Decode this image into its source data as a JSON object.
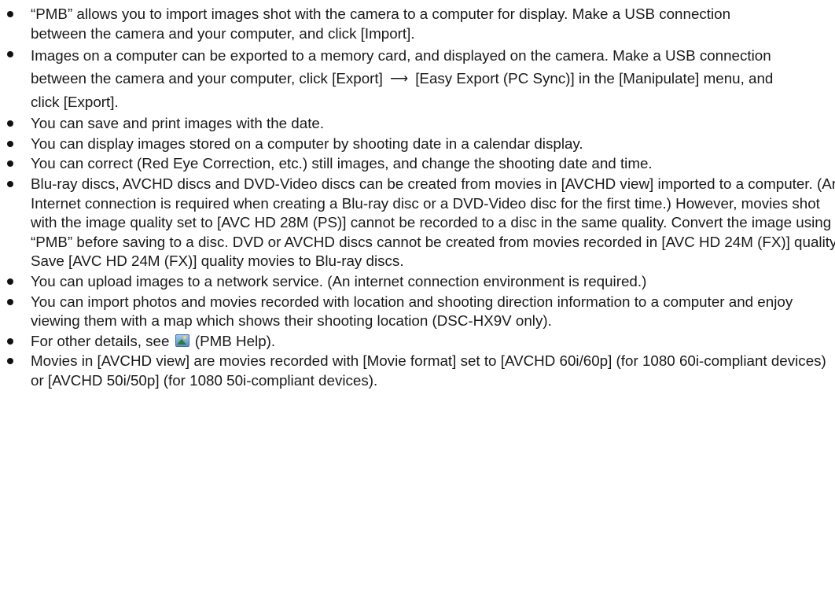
{
  "items": [
    {
      "lines": [
        "“PMB” allows you to import images shot with the camera to a computer for display. Make a USB connection between the camera and your computer, and click [Import]."
      ]
    },
    {
      "part1": "Images on a computer can be exported to a memory card, and displayed on the camera. Make a USB connection between the camera and your computer, click [Export]",
      "arrow": "⟶",
      "part2": "[Easy Export (PC Sync)] in the [Manipulate] menu, and click [Export]."
    },
    {
      "lines": [
        "You can save and print images with the date."
      ]
    },
    {
      "lines": [
        "You can display images stored on a computer by shooting date in a calendar display."
      ]
    },
    {
      "lines": [
        "You can correct (Red Eye Correction, etc.) still images, and change the shooting date and time."
      ]
    },
    {
      "lines": [
        "Blu-ray discs, AVCHD discs and DVD-Video discs can be created from movies in [AVCHD view] imported to a computer. (An Internet connection is required when creating a Blu-ray disc or a DVD-Video disc for the first time.) However, movies shot with the image quality set to [AVC HD 28M (PS)] cannot be recorded to a disc in the same quality. Convert the image using “PMB” before saving to a disc. DVD or AVCHD discs cannot be created from movies recorded in [AVC HD 24M (FX)] quality. Save [AVC HD 24M (FX)] quality movies to Blu-ray discs."
      ]
    },
    {
      "lines": [
        "You can upload images to a network service. (An internet connection environment is required.)"
      ]
    },
    {
      "lines": [
        "You can import photos and movies recorded with location and shooting direction information to a computer and enjoy viewing them with a map which shows their shooting location (DSC-HX9V only)."
      ]
    },
    {
      "before": "For other details, see",
      "icon": "pmb-help-icon",
      "after": "(PMB Help)."
    },
    {
      "lines": [
        "Movies in [AVCHD view] are movies recorded with [Movie format] set to [AVCHD 60i/60p] (for 1080 60i-compliant devices) or [AVCHD 50i/50p] (for 1080 50i-compliant devices)."
      ]
    }
  ]
}
